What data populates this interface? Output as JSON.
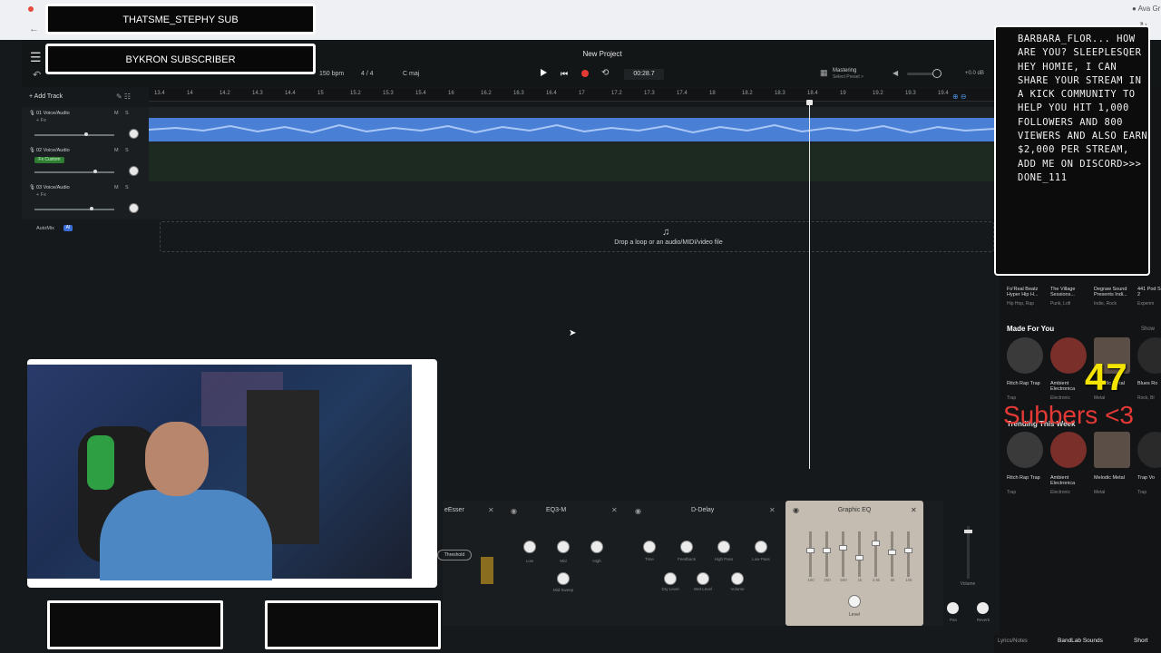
{
  "browser": {
    "back": "←",
    "reload": "↻",
    "ext": "● Ava Gr"
  },
  "header": {
    "project_title": "New Project",
    "bpm": "150 bpm",
    "time_signature": "4 / 4",
    "key": "C maj",
    "time": "00:28.7",
    "mastering": "Mastering",
    "mastering_sub": "Select Preset >",
    "master_db": "+0.0 dB"
  },
  "toolbar": {
    "add_track": "+ Add Track"
  },
  "ruler": {
    "ticks": [
      "13.4",
      "14",
      "14.2",
      "14.3",
      "14.4",
      "15",
      "15.2",
      "15.3",
      "15.4",
      "16",
      "16.2",
      "16.3",
      "16.4",
      "17",
      "17.2",
      "17.3",
      "17.4",
      "18",
      "18.2",
      "18.3",
      "18.4",
      "19",
      "19.2",
      "19.3",
      "19.4"
    ]
  },
  "tracks": [
    {
      "name": "01 Voice/Audio",
      "fx": "+ Fx",
      "m": "M",
      "s": "S"
    },
    {
      "name": "02 Voice/Audio",
      "fx": "Fx Custom",
      "m": "M",
      "s": "S"
    },
    {
      "name": "03 Voice/Audio",
      "fx": "+ Fx",
      "m": "M",
      "s": "S"
    }
  ],
  "automix": {
    "label": "AutoMix",
    "badge": "AI"
  },
  "drop_zone": {
    "text": "Drop a loop or an audio/MIDI/video file"
  },
  "overlays": {
    "sub1": "THATSME_STEPHY SUB",
    "sub2": "BYKRON SUBSCRIBER",
    "chat": "BARBARA_FLOR... HOW ARE YOU? SLEEPLESQER HEY HOMIE, I CAN SHARE YOUR STREAM IN A KICK COMMUNITY TO HELP YOU HIT 1,000 FOLLOWERS AND 800 VIEWERS AND ALSO EARN $2,000 PER STREAM, ADD ME ON DISCORD>>> DONE_111",
    "count": "47",
    "subbers": "Subbers <3"
  },
  "sounds": {
    "top_row": [
      {
        "name": "Fo'Real Beatz Hyper Hip H...",
        "genre": "Hip Hop, Rap"
      },
      {
        "name": "The Village Sessions...",
        "genre": "Punk, Lofi"
      },
      {
        "name": "Degraw Sound Presents Indi...",
        "genre": "Indie, Rock"
      },
      {
        "name": "441 Pod Season 2",
        "genre": "Experim"
      }
    ],
    "made_for_you": "Made For You",
    "show_all": "Show",
    "row1": [
      {
        "name": "Ritch Rap Trap",
        "genre": "Trap"
      },
      {
        "name": "Ambient Electronica",
        "genre": "Electronic"
      },
      {
        "name": "Melodic Metal",
        "genre": "Metal"
      },
      {
        "name": "Blues Ro",
        "genre": "Rock, Bl"
      }
    ],
    "trending": "Trending This Week",
    "row2": [
      {
        "name": "Ritch Rap Trap",
        "genre": "Trap"
      },
      {
        "name": "Ambient Electronica",
        "genre": "Electronic"
      },
      {
        "name": "Melodic Metal",
        "genre": "Metal"
      },
      {
        "name": "Trap Vo",
        "genre": "Trap"
      }
    ]
  },
  "effects": {
    "deesser": "eEsser",
    "threshold": "Threshold",
    "eq3m": {
      "title": "EQ3-M",
      "knobs": [
        "Low",
        "Mid",
        "High",
        "Mid Sweep"
      ]
    },
    "delay": {
      "title": "D-Delay",
      "knobs": [
        "Time",
        "Feedback",
        "High Pass",
        "Low Pass",
        "Dry Level",
        "Wet Level",
        "Volume"
      ]
    },
    "geq": {
      "title": "Graphic EQ",
      "bands": [
        "100",
        "250",
        "500",
        "1k",
        "2.5k",
        "5k",
        "10k"
      ],
      "level": "Level"
    },
    "volume": "Volume",
    "pan": "Pan",
    "reverb": "Reverb"
  },
  "bottom_bar": {
    "lyrics": "Lyrics/Notes",
    "sounds": "BandLab Sounds",
    "shortcuts": "Short"
  },
  "colors": {
    "accent": "#4a90e2",
    "record": "#e53935",
    "waveform": "#5b8fe0",
    "count": "#f5e400",
    "subbers": "#e53935"
  },
  "icons": {
    "play": "play-icon",
    "record": "record-icon",
    "loop": "loop-icon",
    "skip": "skip-back-icon"
  }
}
